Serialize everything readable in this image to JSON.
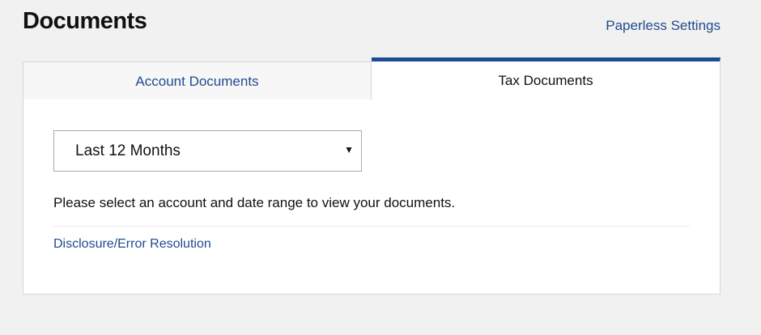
{
  "header": {
    "title": "Documents",
    "paperless_link": "Paperless Settings"
  },
  "tabs": [
    {
      "label": "Account Documents",
      "active": false
    },
    {
      "label": "Tax Documents",
      "active": true
    }
  ],
  "panel": {
    "date_range_select": {
      "value": "Last 12 Months",
      "caret_icon": "triangle-down"
    },
    "message": "Please select an account and date range to view your documents.",
    "disclosure_link": "Disclosure/Error Resolution"
  },
  "colors": {
    "link": "#1f4b8f",
    "active_tab_accent": "#1d4c94",
    "page_background": "#f1f1f1"
  }
}
